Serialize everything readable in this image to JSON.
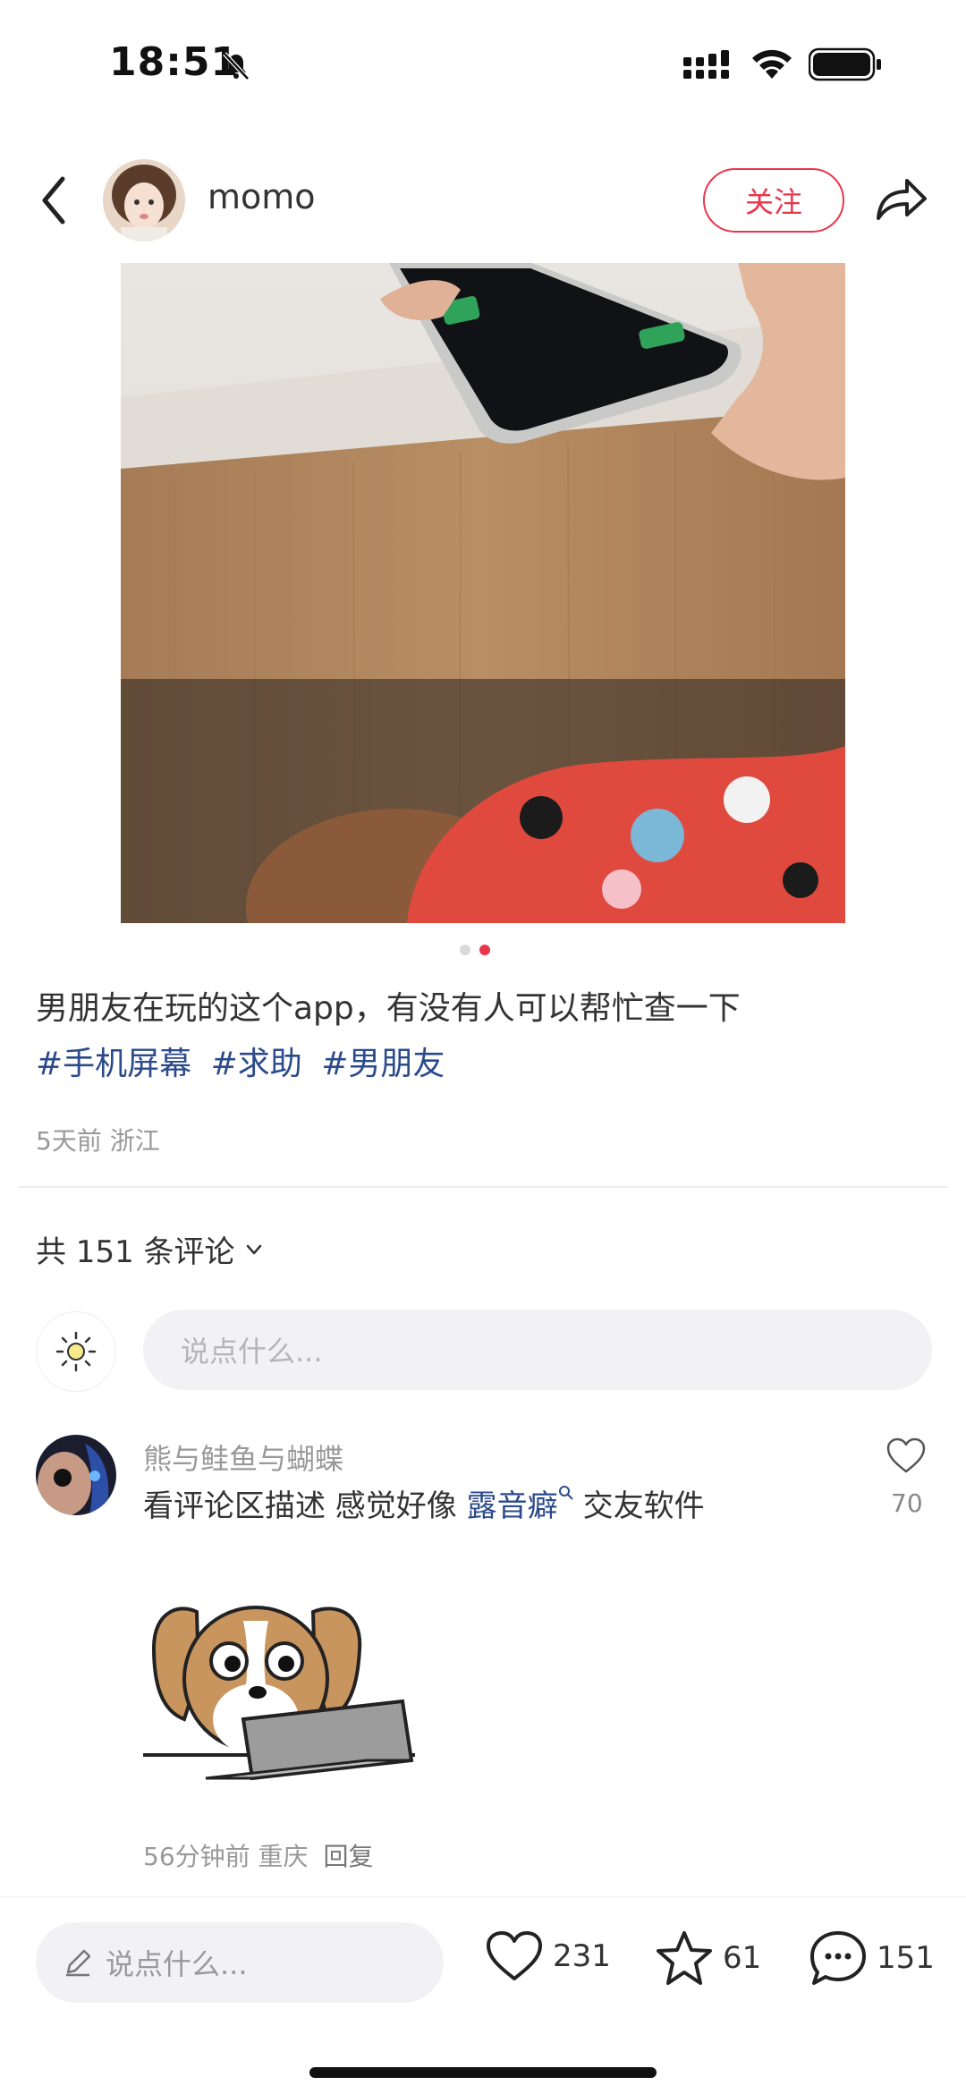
{
  "status_bar": {
    "time": "18:51"
  },
  "header": {
    "author": "momo",
    "follow_label": "关注"
  },
  "post": {
    "text": "男朋友在玩的这个app，有没有人可以帮忙查一下",
    "tags": [
      "#手机屏幕",
      "#求助",
      "#男朋友"
    ],
    "meta": "5天前 浙江",
    "image_count": 2,
    "current_image": 2
  },
  "comments": {
    "count_label": "共 151 条评论",
    "input_placeholder": "说点什么...",
    "items": [
      {
        "name": "熊与鲑鱼与蝴蝶",
        "text_before": "看评论区描述 感觉好像 ",
        "link": "露音癖",
        "text_after": "交友软件",
        "likes": "70",
        "time": "56分钟前 重庆",
        "reply_label": "回复"
      }
    ]
  },
  "bottom_bar": {
    "input_placeholder": "说点什么...",
    "likes": "231",
    "favorites": "61",
    "comments": "151"
  },
  "colors": {
    "accent": "#e8364b",
    "tag": "#2b4a8b"
  }
}
